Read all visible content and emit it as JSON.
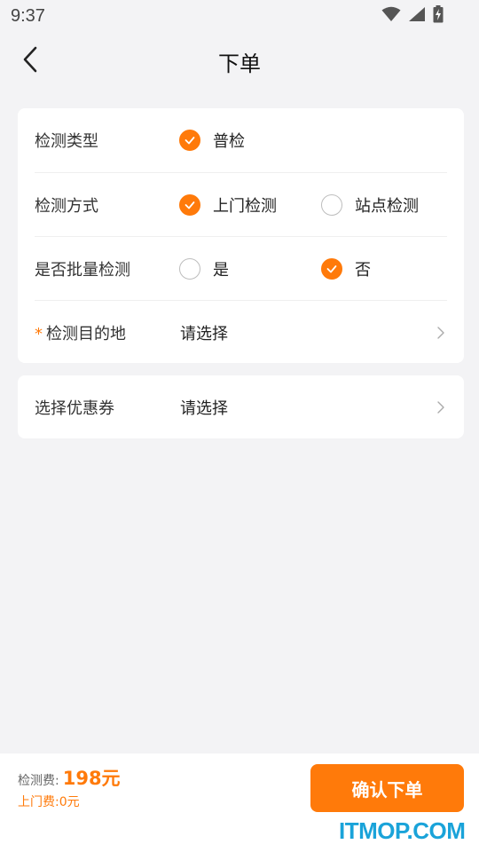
{
  "status_bar": {
    "time": "9:37",
    "icons": [
      "wifi-icon",
      "cellular-signal-icon",
      "battery-charging-icon"
    ]
  },
  "header": {
    "title": "下单",
    "back_icon": "chevron-left-icon"
  },
  "form": {
    "detection_type": {
      "label": "检测类型",
      "options": [
        {
          "label": "普检",
          "checked": true
        }
      ]
    },
    "detection_method": {
      "label": "检测方式",
      "options": [
        {
          "label": "上门检测",
          "checked": true
        },
        {
          "label": "站点检测",
          "checked": false
        }
      ]
    },
    "batch_detection": {
      "label": "是否批量检测",
      "options": [
        {
          "label": "是",
          "checked": false
        },
        {
          "label": "否",
          "checked": true
        }
      ]
    },
    "destination": {
      "required_mark": "*",
      "label": "检测目的地",
      "value": "请选择"
    }
  },
  "coupon": {
    "label": "选择优惠券",
    "value": "请选择"
  },
  "footer": {
    "detection_fee_label": "检测费:",
    "detection_fee_amount": "198元",
    "visit_fee_text": "上门费:0元",
    "confirm_label": "确认下单",
    "watermark": "ITMOP.COM"
  },
  "colors": {
    "accent": "#ff7a0a",
    "background": "#f3f3f5",
    "card": "#ffffff",
    "watermark": "#1aa3d9"
  }
}
